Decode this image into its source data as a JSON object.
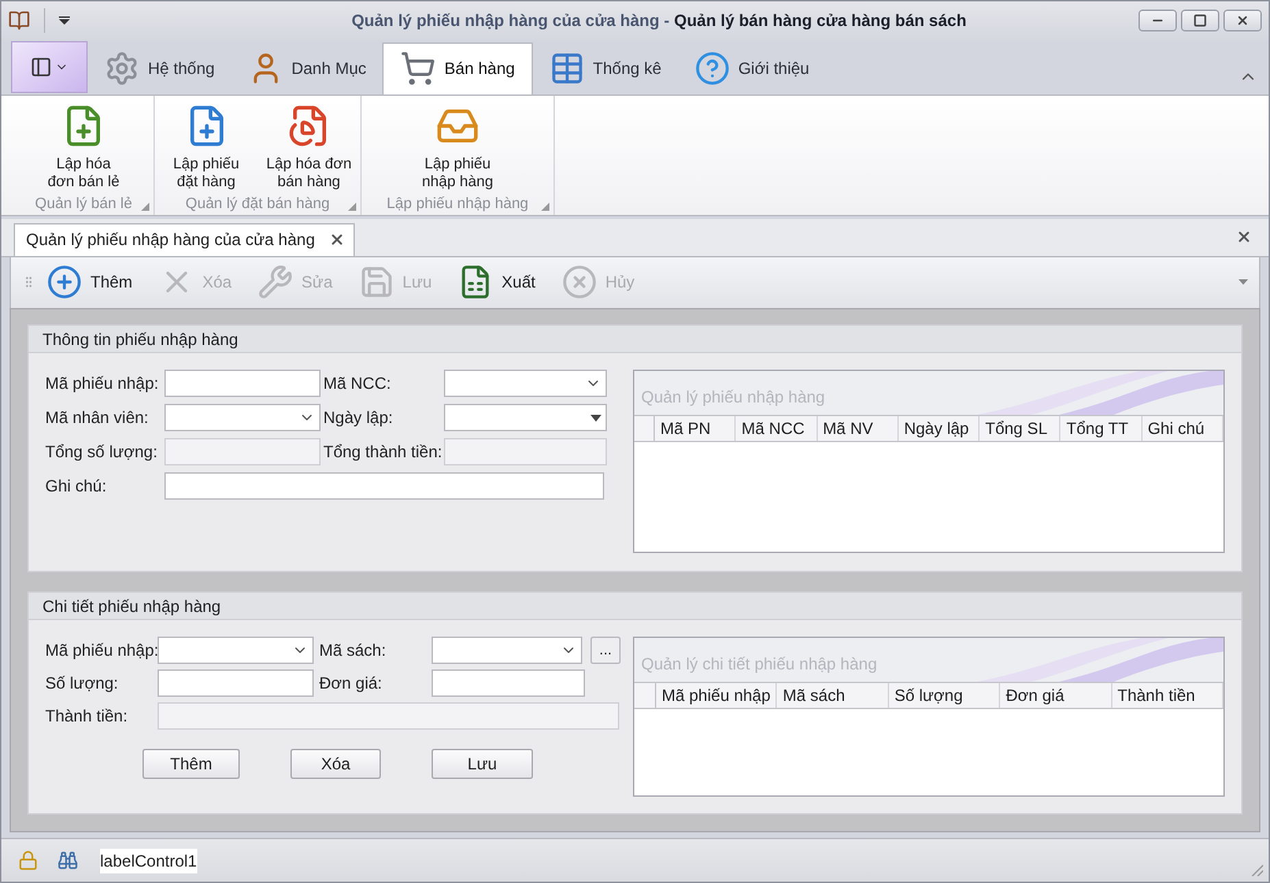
{
  "window": {
    "document_title": "Quản lý phiếu nhập hàng của cửa hàng",
    "separator": "-",
    "app_title": "Quản lý bán hàng cửa hàng bán sách"
  },
  "ribbon_tabs": [
    {
      "label": "Hệ thống",
      "selected": false
    },
    {
      "label": "Danh Mục",
      "selected": false
    },
    {
      "label": "Bán hàng",
      "selected": true
    },
    {
      "label": "Thống kê",
      "selected": false
    },
    {
      "label": "Giới thiệu",
      "selected": false
    }
  ],
  "ribbon_groups": [
    {
      "label": "Quản lý bán lẻ",
      "buttons": [
        {
          "label": "Lập hóa\nđơn bán lẻ"
        }
      ]
    },
    {
      "label": "Quản lý đặt bán hàng",
      "buttons": [
        {
          "label": "Lập phiếu\nđặt hàng"
        },
        {
          "label": "Lập hóa đơn\nbán hàng"
        }
      ]
    },
    {
      "label": "Lập phiếu nhập hàng",
      "buttons": [
        {
          "label": "Lập phiếu\nnhập hàng"
        }
      ]
    }
  ],
  "document_tabs": [
    {
      "label": "Quản lý phiếu nhập hàng của cửa hàng",
      "selected": true
    }
  ],
  "toolbar": [
    {
      "label": "Thêm",
      "disabled": false
    },
    {
      "label": "Xóa",
      "disabled": true
    },
    {
      "label": "Sửa",
      "disabled": true
    },
    {
      "label": "Lưu",
      "disabled": true
    },
    {
      "label": "Xuất",
      "disabled": false
    },
    {
      "label": "Hủy",
      "disabled": true
    }
  ],
  "sections": [
    {
      "title": "Thông tin phiếu nhập hàng",
      "fields": [
        {
          "label": "Mã phiếu nhập:",
          "kind": "text"
        },
        {
          "label": "Mã NCC:",
          "kind": "combo"
        },
        {
          "label": "Mã nhân viên:",
          "kind": "combo"
        },
        {
          "label": "Ngày lập:",
          "kind": "date"
        },
        {
          "label": "Tổng số lượng:",
          "kind": "readonly"
        },
        {
          "label": "Tổng thành tiền:",
          "kind": "readonly"
        },
        {
          "label": "Ghi chú:",
          "kind": "text"
        }
      ],
      "grid": {
        "caption": "Quản lý phiếu nhập hàng",
        "columns": [
          "Mã PN",
          "Mã NCC",
          "Mã NV",
          "Ngày lập",
          "Tổng SL",
          "Tổng TT",
          "Ghi chú"
        ]
      }
    },
    {
      "title": "Chi tiết phiếu nhập hàng",
      "fields": [
        {
          "label": "Mã phiếu nhập:",
          "kind": "combo"
        },
        {
          "label": "Mã sách:",
          "kind": "combo",
          "button": "..."
        },
        {
          "label": "Số lượng:",
          "kind": "text"
        },
        {
          "label": "Đơn giá:",
          "kind": "text"
        },
        {
          "label": "Thành tiền:",
          "kind": "readonly"
        }
      ],
      "buttons": [
        "Thêm",
        "Xóa",
        "Lưu"
      ],
      "grid": {
        "caption": "Quản lý chi tiết phiếu nhập hàng",
        "columns": [
          "Mã phiếu nhập",
          "Mã sách",
          "Số lượng",
          "Đơn giá",
          "Thành tiền"
        ]
      }
    }
  ],
  "status_bar": {
    "label": "labelControl1"
  }
}
